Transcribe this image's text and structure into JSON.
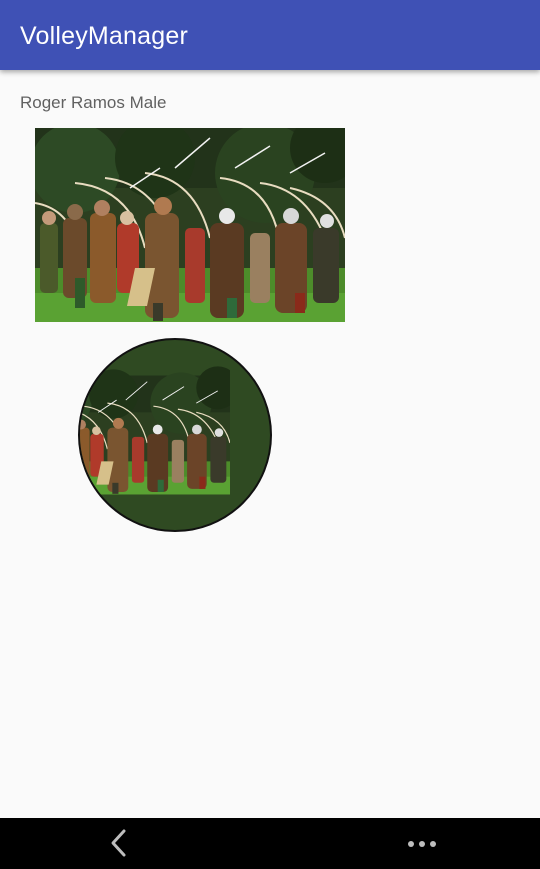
{
  "appbar": {
    "title": "VolleyManager",
    "color": "#3f51b5"
  },
  "content": {
    "user_line": "Roger Ramos Male",
    "photo_rect_icon": "archers-photo",
    "photo_circle_icon": "archers-photo-circular"
  },
  "navbar": {
    "back_icon": "back-chevron-icon",
    "more_icon": "more-dots-icon"
  }
}
